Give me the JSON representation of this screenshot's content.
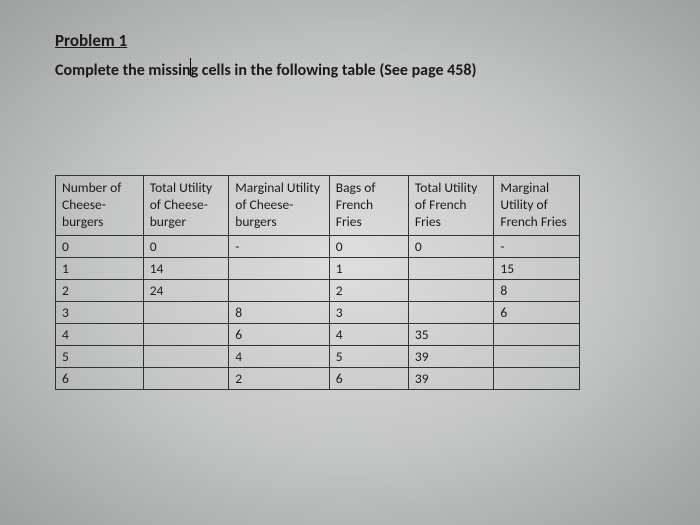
{
  "title": "Problem 1",
  "instruction": "Complete the missing cells in the following table (See page 458)",
  "headers": [
    "Number of Cheese-burgers",
    "Total Utility of Cheese-burger",
    "Marginal Utility of Cheese-burgers",
    "Bags of French Fries",
    "Total Utility of French Fries",
    "Marginal Utility of French Fries"
  ],
  "rows": [
    [
      "0",
      "0",
      "-",
      "0",
      "0",
      "-"
    ],
    [
      "1",
      "14",
      "",
      "1",
      "",
      "15"
    ],
    [
      "2",
      "24",
      "",
      "2",
      "",
      "8"
    ],
    [
      "3",
      "",
      "8",
      "3",
      "",
      "6"
    ],
    [
      "4",
      "",
      "6",
      "4",
      "35",
      ""
    ],
    [
      "5",
      "",
      "4",
      "5",
      "39",
      ""
    ],
    [
      "6",
      "",
      "2",
      "6",
      "39",
      ""
    ]
  ]
}
